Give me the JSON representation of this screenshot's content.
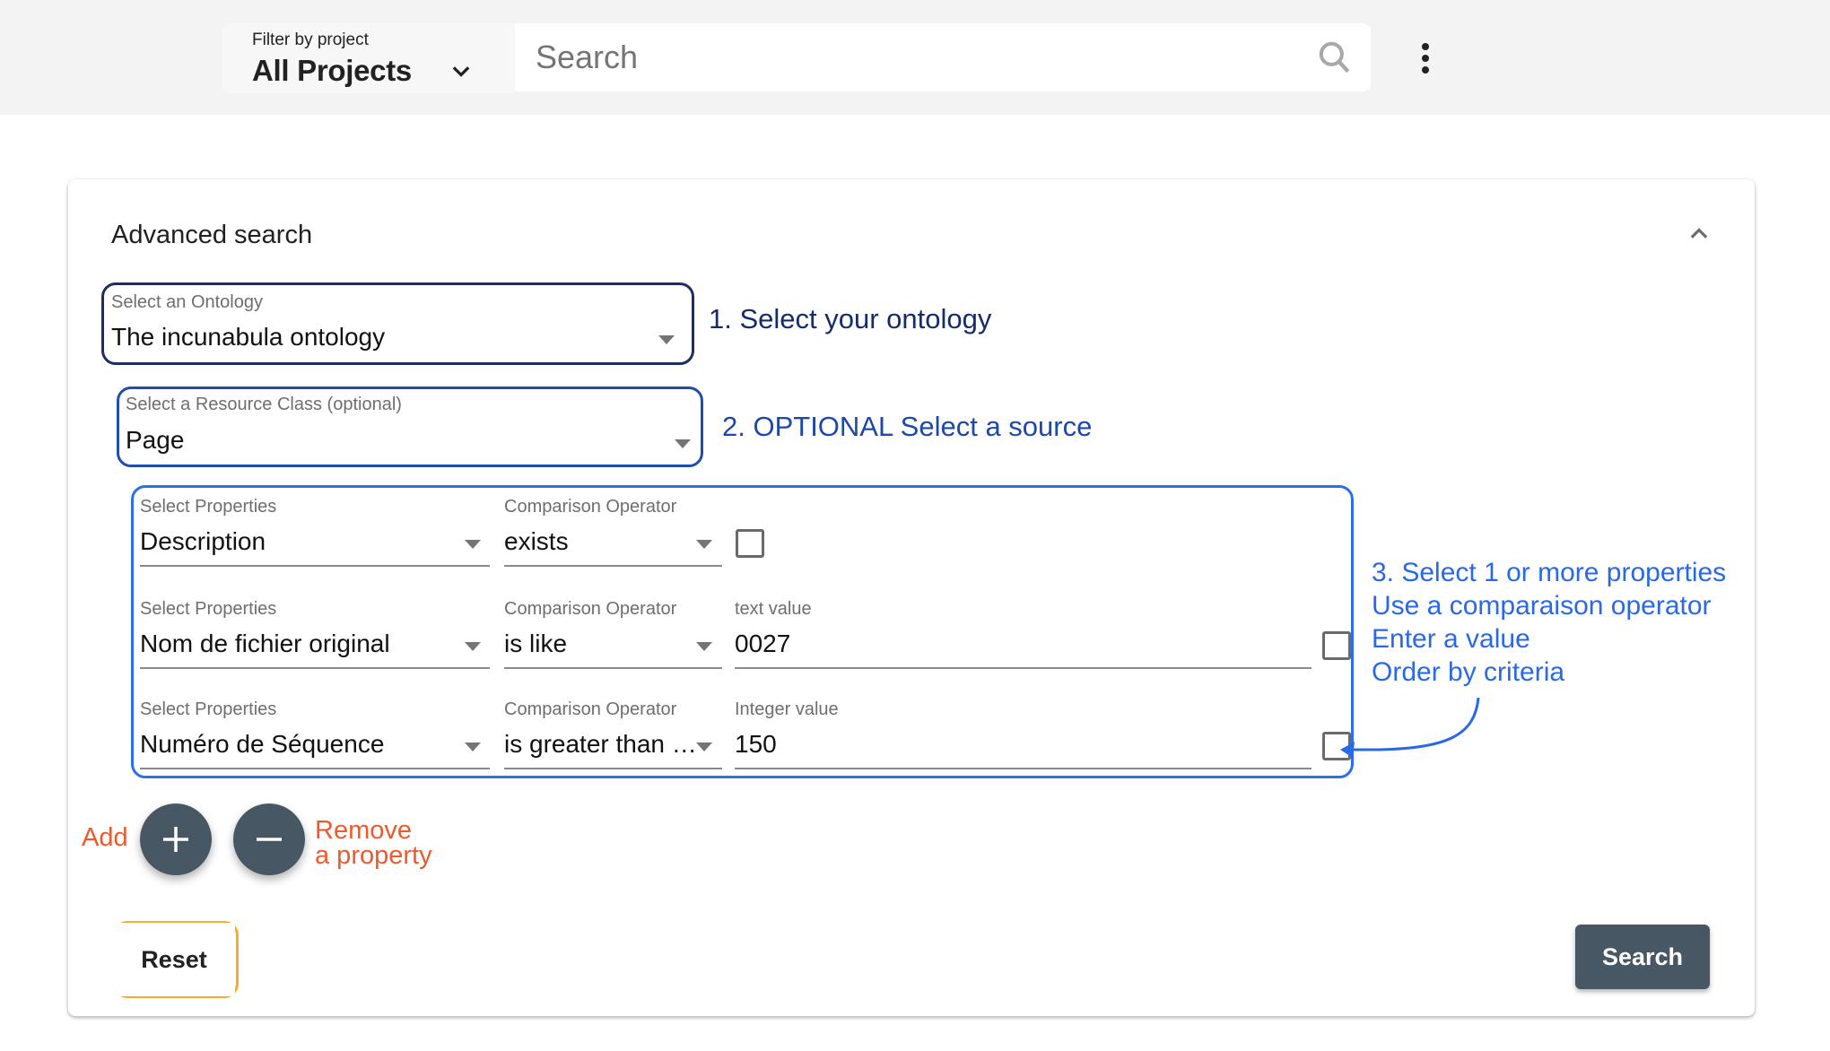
{
  "topbar": {
    "project_filter": {
      "label": "Filter by project",
      "value": "All Projects"
    },
    "search": {
      "placeholder": "Search"
    },
    "icons": {
      "dropdown": "chevron-down-icon",
      "search": "search-icon",
      "menu": "more-vert-icon"
    }
  },
  "advanced_search": {
    "title": "Advanced search",
    "collapse_icon": "chevron-up-icon",
    "ontology": {
      "label": "Select an Ontology",
      "value": "The incunabula ontology"
    },
    "resource_class": {
      "label": "Select a Resource Class (optional)",
      "value": "Page"
    },
    "property_rows": [
      {
        "property_label": "Select Properties",
        "property_value": "Description",
        "operator_label": "Comparison Operator",
        "operator_value": "exists",
        "value_label": "",
        "value": "",
        "sort_checked": false
      },
      {
        "property_label": "Select Properties",
        "property_value": "Nom de fichier original",
        "operator_label": "Comparison Operator",
        "operator_value": "is like",
        "value_label": "text value",
        "value": "0027",
        "sort_checked": false
      },
      {
        "property_label": "Select Properties",
        "property_value": "Numéro de Séquence",
        "operator_label": "Comparison Operator",
        "operator_value": "is greater than …",
        "value_label": "Integer value",
        "value": "150",
        "sort_checked": false
      }
    ],
    "add_button_icon": "plus-icon",
    "remove_button_icon": "minus-icon",
    "reset_label": "Reset",
    "search_label": "Search"
  },
  "annotations": {
    "step1": "1. Select your ontology",
    "step2": "2. OPTIONAL Select a source",
    "step3_lines": [
      "3. Select 1 or more properties",
      "Use a comparaison operator",
      "Enter a value",
      "Order by criteria"
    ],
    "add": "Add",
    "remove_line1": "Remove",
    "remove_line2": "a property",
    "colors": {
      "step1": "#142d6a",
      "step2": "#1c48a8",
      "step3": "#2a69e6",
      "add_remove": "#ec5a2f",
      "reset_highlight": "#f5ab2c"
    }
  },
  "theme": {
    "button_color": "#475864",
    "topbar_bg": "#f3f3f3"
  }
}
